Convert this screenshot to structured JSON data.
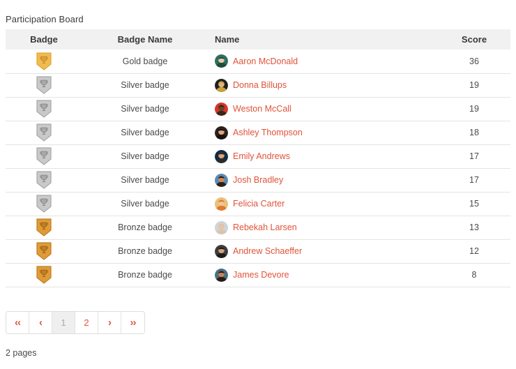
{
  "board": {
    "title": "Participation Board",
    "columns": {
      "badge": "Badge",
      "badge_name": "Badge Name",
      "name": "Name",
      "score": "Score"
    },
    "rows": [
      {
        "badge_type": "gold",
        "badge_name": "Gold badge",
        "person": "Aaron McDonald",
        "score": "36",
        "avatar_icon": "avatar-aaron-mcdonald"
      },
      {
        "badge_type": "silver",
        "badge_name": "Silver badge",
        "person": "Donna Billups",
        "score": "19",
        "avatar_icon": "avatar-donna-billups"
      },
      {
        "badge_type": "silver",
        "badge_name": "Silver badge",
        "person": "Weston McCall",
        "score": "19",
        "avatar_icon": "avatar-weston-mccall"
      },
      {
        "badge_type": "silver",
        "badge_name": "Silver badge",
        "person": "Ashley Thompson",
        "score": "18",
        "avatar_icon": "avatar-ashley-thompson"
      },
      {
        "badge_type": "silver",
        "badge_name": "Silver badge",
        "person": "Emily Andrews",
        "score": "17",
        "avatar_icon": "avatar-emily-andrews"
      },
      {
        "badge_type": "silver",
        "badge_name": "Silver badge",
        "person": "Josh Bradley",
        "score": "17",
        "avatar_icon": "avatar-josh-bradley"
      },
      {
        "badge_type": "silver",
        "badge_name": "Silver badge",
        "person": "Felicia Carter",
        "score": "15",
        "avatar_icon": "avatar-felicia-carter"
      },
      {
        "badge_type": "bronze",
        "badge_name": "Bronze badge",
        "person": "Rebekah Larsen",
        "score": "13",
        "avatar_icon": "avatar-rebekah-larsen"
      },
      {
        "badge_type": "bronze",
        "badge_name": "Bronze badge",
        "person": "Andrew Schaeffer",
        "score": "12",
        "avatar_icon": "avatar-andrew-schaeffer"
      },
      {
        "badge_type": "bronze",
        "badge_name": "Bronze badge",
        "person": "James Devore",
        "score": "8",
        "avatar_icon": "avatar-james-devore"
      }
    ]
  },
  "pagination": {
    "first_label": "‹‹",
    "prev_label": "‹",
    "next_label": "›",
    "last_label": "››",
    "pages": [
      "1",
      "2"
    ],
    "current_page": "1",
    "pages_note": "2 pages"
  },
  "colors": {
    "link": "#e0533a",
    "header_bg": "#f1f1f1",
    "row_border": "#e4e4e4",
    "gold": "#f2bb4f",
    "gold_dark": "#e0a53b",
    "silver": "#c9c9c9",
    "silver_dark": "#a8a8a8",
    "bronze": "#e09a38",
    "bronze_dark": "#c07f23"
  }
}
